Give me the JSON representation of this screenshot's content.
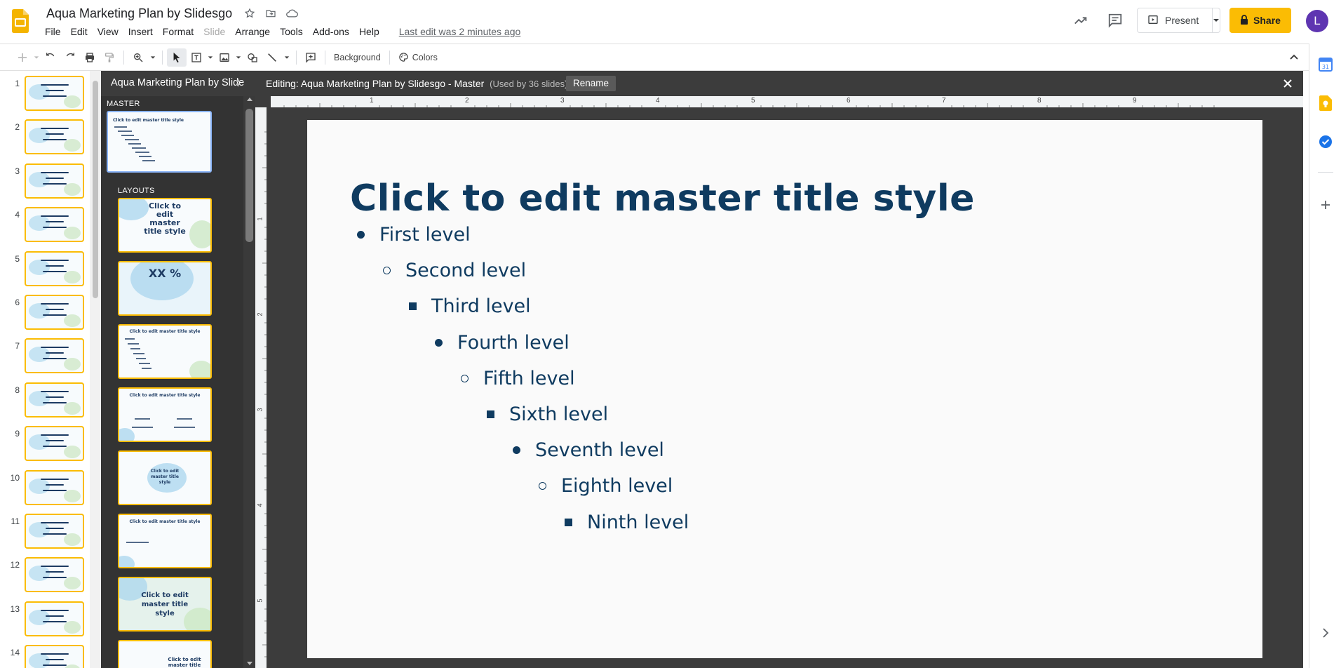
{
  "app": {
    "doc_title": "Aqua Marketing Plan by Slidesgo",
    "last_edit": "Last edit was 2 minutes ago",
    "menu": [
      "File",
      "Edit",
      "View",
      "Insert",
      "Format",
      "Slide",
      "Arrange",
      "Tools",
      "Add-ons",
      "Help"
    ],
    "menu_disabled": [
      "Slide"
    ],
    "present_label": "Present",
    "share_label": "Share",
    "avatar_initial": "L",
    "brand_color": "#fbbc04",
    "avatar_color": "#5e35b1"
  },
  "toolbar": {
    "background_label": "Background",
    "colors_label": "Colors"
  },
  "filmstrip": {
    "slide_numbers": [
      "1",
      "2",
      "3",
      "4",
      "5",
      "6",
      "7",
      "8",
      "9",
      "10",
      "11",
      "12",
      "13",
      "14"
    ]
  },
  "master_editor": {
    "theme_name": "Aqua Marketing Plan by Slidesgo",
    "editing_label": "Editing: Aqua Marketing Plan by Slidesgo - Master",
    "used_by": "(Used by 36 slides)",
    "rename_label": "Rename",
    "master_section": "MASTER",
    "layouts_section": "LAYOUTS",
    "master_thumb_title": "Click to edit master title style",
    "layout_thumbs": [
      {
        "title": "Click to edit master title style"
      },
      {
        "title": "XX %"
      },
      {
        "title": "Click to edit master title style"
      },
      {
        "title": "Click to edit master title style"
      },
      {
        "title": "Click to edit master title style"
      },
      {
        "title": "Click to edit master title style"
      },
      {
        "title": "Click to edit master title style"
      },
      {
        "title": "Click to edit master title style"
      }
    ]
  },
  "ruler": {
    "h_marks": [
      "1",
      "2",
      "3",
      "4",
      "5",
      "6",
      "7",
      "8",
      "9"
    ],
    "v_marks": [
      "1",
      "2",
      "3",
      "4",
      "5"
    ]
  },
  "slide": {
    "title": "Click to edit master title style",
    "title_color": "#0f3b60",
    "levels": [
      {
        "text": "First level",
        "bullet": "disc"
      },
      {
        "text": "Second level",
        "bullet": "circle"
      },
      {
        "text": "Third level",
        "bullet": "square"
      },
      {
        "text": "Fourth level",
        "bullet": "disc"
      },
      {
        "text": "Fifth level",
        "bullet": "circle"
      },
      {
        "text": "Sixth level",
        "bullet": "square"
      },
      {
        "text": "Seventh level",
        "bullet": "disc"
      },
      {
        "text": "Eighth level",
        "bullet": "circle"
      },
      {
        "text": "Ninth level",
        "bullet": "square"
      }
    ]
  },
  "side_panel": {
    "icons": [
      "calendar-icon",
      "keep-icon",
      "tasks-icon",
      "add-icon"
    ]
  }
}
